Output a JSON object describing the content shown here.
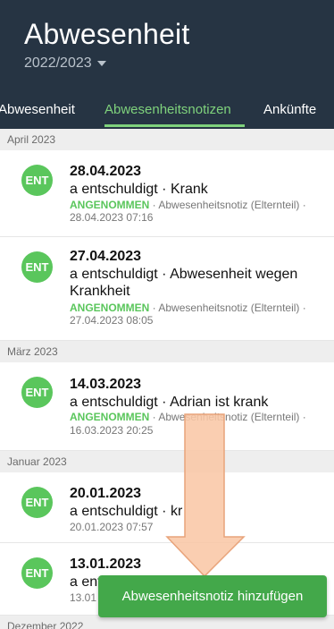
{
  "header": {
    "title": "Abwesenheit",
    "year": "2022/2023",
    "tabs": [
      {
        "label": "Abwesenheit"
      },
      {
        "label": "Abwesenheitsnotizen"
      },
      {
        "label": "Ankünfte"
      }
    ]
  },
  "sections": [
    {
      "label": "April 2023"
    },
    {
      "label": "März 2023"
    },
    {
      "label": "Januar 2023"
    },
    {
      "label": "Dezember 2022"
    }
  ],
  "items": [
    {
      "avatar": "ENT",
      "date": "28.04.2023",
      "desc": "a entschuldigt · Krank",
      "status": "ANGENOMMEN",
      "meta": " · Abwesenheitsnotiz (Elternteil) ·",
      "timestamp": "28.04.2023 07:16"
    },
    {
      "avatar": "ENT",
      "date": "27.04.2023",
      "desc": "a entschuldigt · Abwesenheit wegen Krankheit",
      "status": "ANGENOMMEN",
      "meta": " · Abwesenheitsnotiz (Elternteil) ·",
      "timestamp": "27.04.2023 08:05"
    },
    {
      "avatar": "ENT",
      "date": "14.03.2023",
      "desc": "a entschuldigt · Adrian ist krank",
      "status": "ANGENOMMEN",
      "meta": " · Abwesenheitsnotiz (Elternteil) ·",
      "timestamp": "16.03.2023 20:25"
    },
    {
      "avatar": "ENT",
      "date": "20.01.2023",
      "desc": "a entschuldigt · kr",
      "timestamp": "20.01.2023 07:57"
    },
    {
      "avatar": "ENT",
      "date": "13.01.2023",
      "desc": "a ent",
      "timestamp": "13.01"
    }
  ],
  "fab": {
    "label": "Abwesenheitsnotiz hinzufügen"
  },
  "colors": {
    "header": "#263443",
    "accent": "#7fd27c",
    "avatar": "#5ac65c",
    "fab": "#43a84a",
    "arrow": "#f9c7a6"
  }
}
